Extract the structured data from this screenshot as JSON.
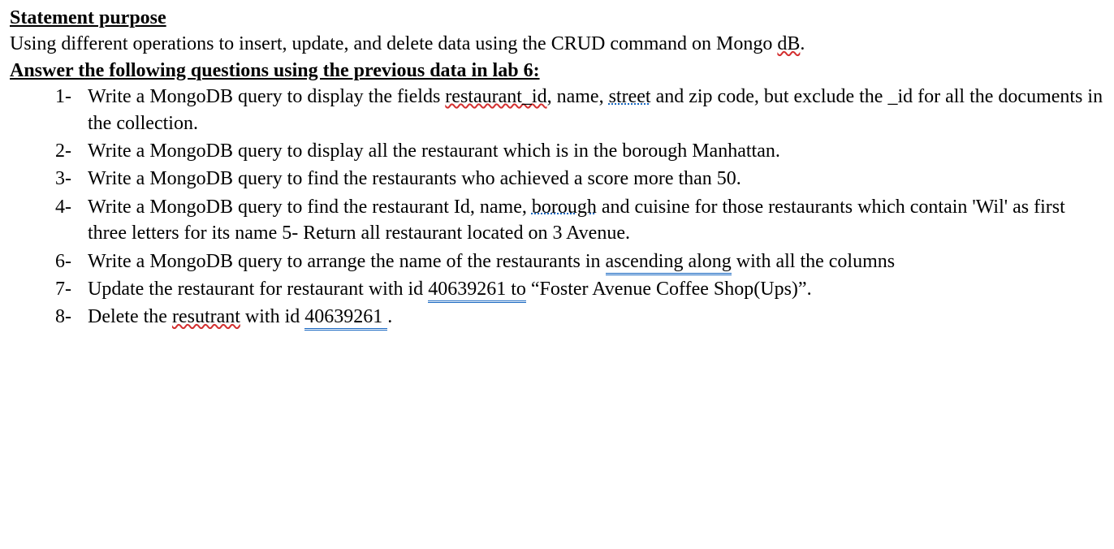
{
  "heading1": "Statement purpose",
  "intro_p1": "Using different operations to insert, update, and delete data using the CRUD command on Mongo ",
  "intro_p2_spell": "dB",
  "intro_p3": ".",
  "heading2": "Answer the following questions using the previous data in lab 6:",
  "items": {
    "1": {
      "num": "1-",
      "a": "Write a MongoDB query to display the fields ",
      "b_spell": "restaurant_id",
      "c": ", name, ",
      "d_blue": "street",
      "e": " and zip code, but exclude the _id for all the documents in the collection."
    },
    "2": {
      "num": "2-",
      "a": "Write a MongoDB query to display all the restaurant which is in the borough Manhattan."
    },
    "3": {
      "num": "3-",
      "a": "Write a MongoDB query to find the restaurants who achieved a score more than 50."
    },
    "4": {
      "num": "4-",
      "a": "Write a MongoDB query to find the restaurant Id, name, ",
      "b_blue": "borough",
      "c": " and cuisine for those restaurants which contain 'Wil' as first three letters for its name 5- Return all restaurant located on 3 Avenue."
    },
    "6": {
      "num": "6-",
      "a": "Write a MongoDB query to arrange the name of the restaurants in ",
      "b_dbl": "ascending  along",
      "c": " with all the columns"
    },
    "7": {
      "num": "7-",
      "a": "Update the restaurant for restaurant with id ",
      "b_dbl": "40639261  to",
      "c": " “Foster Avenue Coffee Shop(Ups)”."
    },
    "8": {
      "num": "8-",
      "a": "Delete the ",
      "b_spell": "resutrant",
      "c": " with id ",
      "d_dbl": "40639261  ",
      "e": "."
    }
  }
}
